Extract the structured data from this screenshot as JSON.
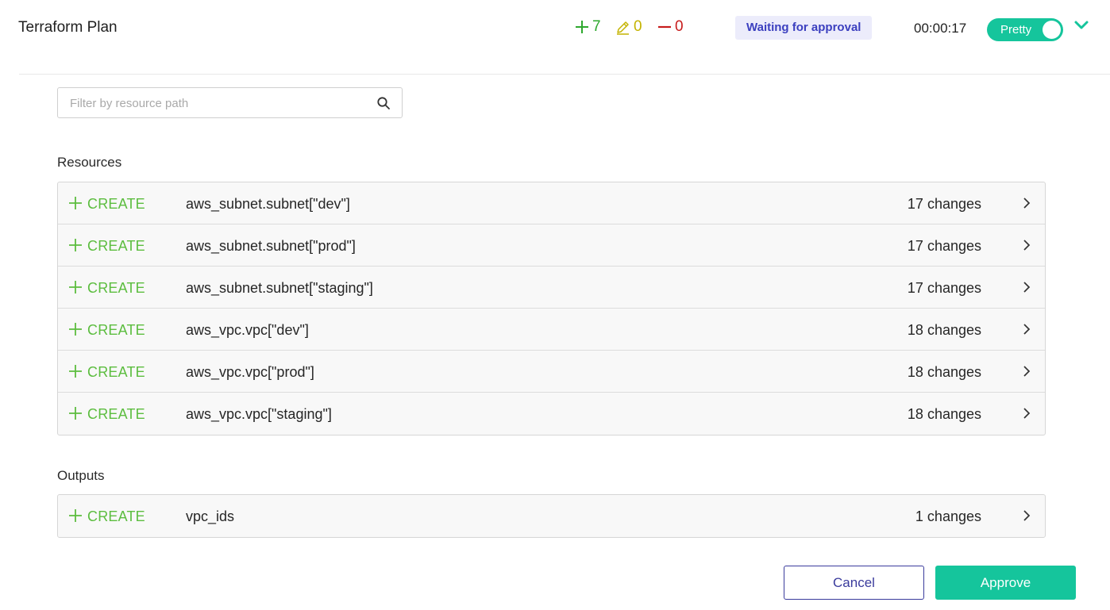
{
  "header": {
    "title": "Terraform Plan",
    "add_count": "7",
    "change_count": "0",
    "destroy_count": "0",
    "status": "Waiting for approval",
    "elapsed": "00:00:17",
    "toggle_label": "Pretty",
    "toggle_on": true
  },
  "filter": {
    "placeholder": "Filter by resource path",
    "value": ""
  },
  "resources": {
    "label": "Resources",
    "items": [
      {
        "action": "CREATE",
        "path": "aws_subnet.subnet[\"dev\"]",
        "changes": "17 changes"
      },
      {
        "action": "CREATE",
        "path": "aws_subnet.subnet[\"prod\"]",
        "changes": "17 changes"
      },
      {
        "action": "CREATE",
        "path": "aws_subnet.subnet[\"staging\"]",
        "changes": "17 changes"
      },
      {
        "action": "CREATE",
        "path": "aws_vpc.vpc[\"dev\"]",
        "changes": "18 changes"
      },
      {
        "action": "CREATE",
        "path": "aws_vpc.vpc[\"prod\"]",
        "changes": "18 changes"
      },
      {
        "action": "CREATE",
        "path": "aws_vpc.vpc[\"staging\"]",
        "changes": "18 changes"
      }
    ]
  },
  "outputs": {
    "label": "Outputs",
    "items": [
      {
        "action": "CREATE",
        "path": "vpc_ids",
        "changes": "1 changes"
      }
    ]
  },
  "buttons": {
    "cancel": "Cancel",
    "approve": "Approve"
  },
  "colors": {
    "add": "#2ea82e",
    "change": "#c4b300",
    "destroy": "#c71c1c",
    "accent": "#15c59c",
    "primary": "#3a3b9c",
    "create_action": "#5cbd3f"
  },
  "icons": {
    "add": "plus-icon",
    "change": "pencil-icon",
    "destroy": "minus-icon",
    "search": "search-icon",
    "expand": "chevron-right-icon",
    "collapse": "chevron-down-icon"
  }
}
